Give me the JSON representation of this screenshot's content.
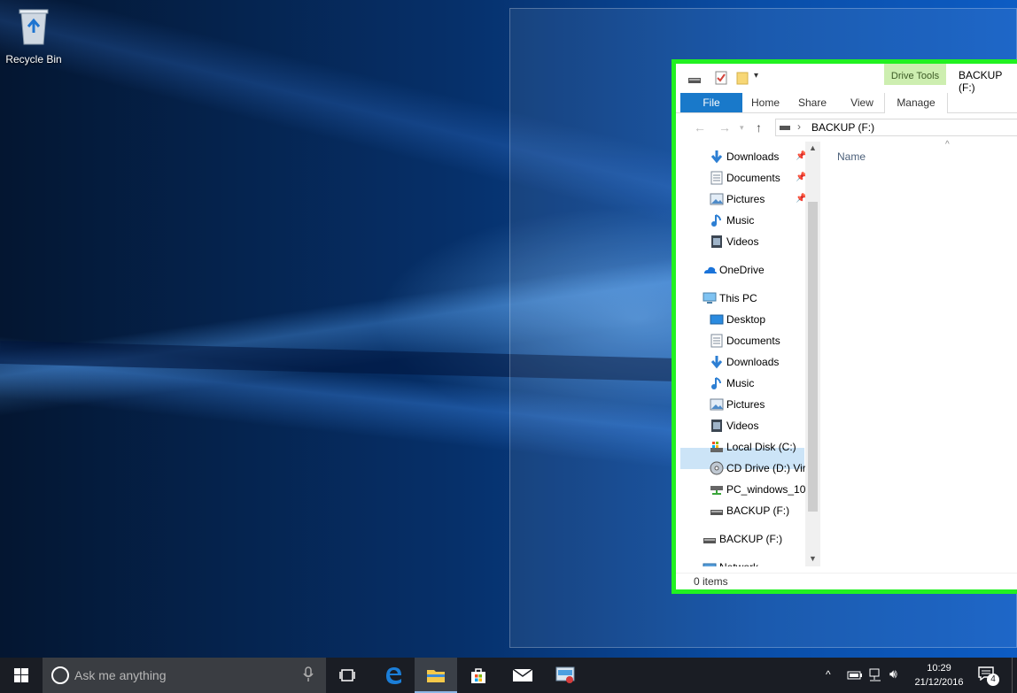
{
  "desktop": {
    "icons": [
      {
        "label": "Recycle Bin",
        "icon": "recycle-bin-icon"
      }
    ]
  },
  "explorer": {
    "title": "BACKUP (F:)",
    "context_tab": "Drive Tools",
    "ribbon_tabs": [
      "File",
      "Home",
      "Share",
      "View",
      "Manage"
    ],
    "address": "BACKUP (F:)",
    "nav_items": [
      {
        "label": "Downloads",
        "icon": "downloads-icon",
        "pinned": true
      },
      {
        "label": "Documents",
        "icon": "documents-icon",
        "pinned": true
      },
      {
        "label": "Pictures",
        "icon": "pictures-icon",
        "pinned": true
      },
      {
        "label": "Music",
        "icon": "music-icon",
        "pinned": false
      },
      {
        "label": "Videos",
        "icon": "videos-icon",
        "pinned": false
      },
      {
        "label": "OneDrive",
        "icon": "onedrive-icon",
        "pinned": false
      },
      {
        "label": "This PC",
        "icon": "this-pc-icon",
        "pinned": false
      },
      {
        "label": "Desktop",
        "icon": "desktop-icon",
        "pinned": false
      },
      {
        "label": "Documents",
        "icon": "documents-icon",
        "pinned": false
      },
      {
        "label": "Downloads",
        "icon": "downloads-icon",
        "pinned": false
      },
      {
        "label": "Music",
        "icon": "music-icon",
        "pinned": false
      },
      {
        "label": "Pictures",
        "icon": "pictures-icon",
        "pinned": false
      },
      {
        "label": "Videos",
        "icon": "videos-icon",
        "pinned": false
      },
      {
        "label": "Local Disk (C:)",
        "icon": "local-disk-icon",
        "pinned": false
      },
      {
        "label": "CD Drive (D:) Vir",
        "icon": "cd-drive-icon",
        "pinned": false
      },
      {
        "label": "PC_windows_10",
        "icon": "network-drive-icon",
        "pinned": false
      },
      {
        "label": "BACKUP (F:)",
        "icon": "usb-drive-icon",
        "pinned": false
      },
      {
        "label": "BACKUP (F:)",
        "icon": "usb-drive-icon",
        "pinned": false,
        "selected": true
      },
      {
        "label": "Network",
        "icon": "network-icon",
        "pinned": false
      }
    ],
    "column_header": "Name",
    "status": "0 items"
  },
  "taskbar": {
    "search_placeholder": "Ask me anything",
    "clock_time": "10:29",
    "clock_date": "21/12/2016",
    "notification_count": "4",
    "pinned_apps": [
      "task-view-icon",
      "edge-icon",
      "file-explorer-icon",
      "store-icon",
      "mail-icon",
      "control-panel-icon"
    ]
  },
  "colors": {
    "highlight_border": "#21f121",
    "drive_tools_tab": "#cdeeb0",
    "file_tab": "#1979ca",
    "taskbar": "#1a1d24"
  }
}
